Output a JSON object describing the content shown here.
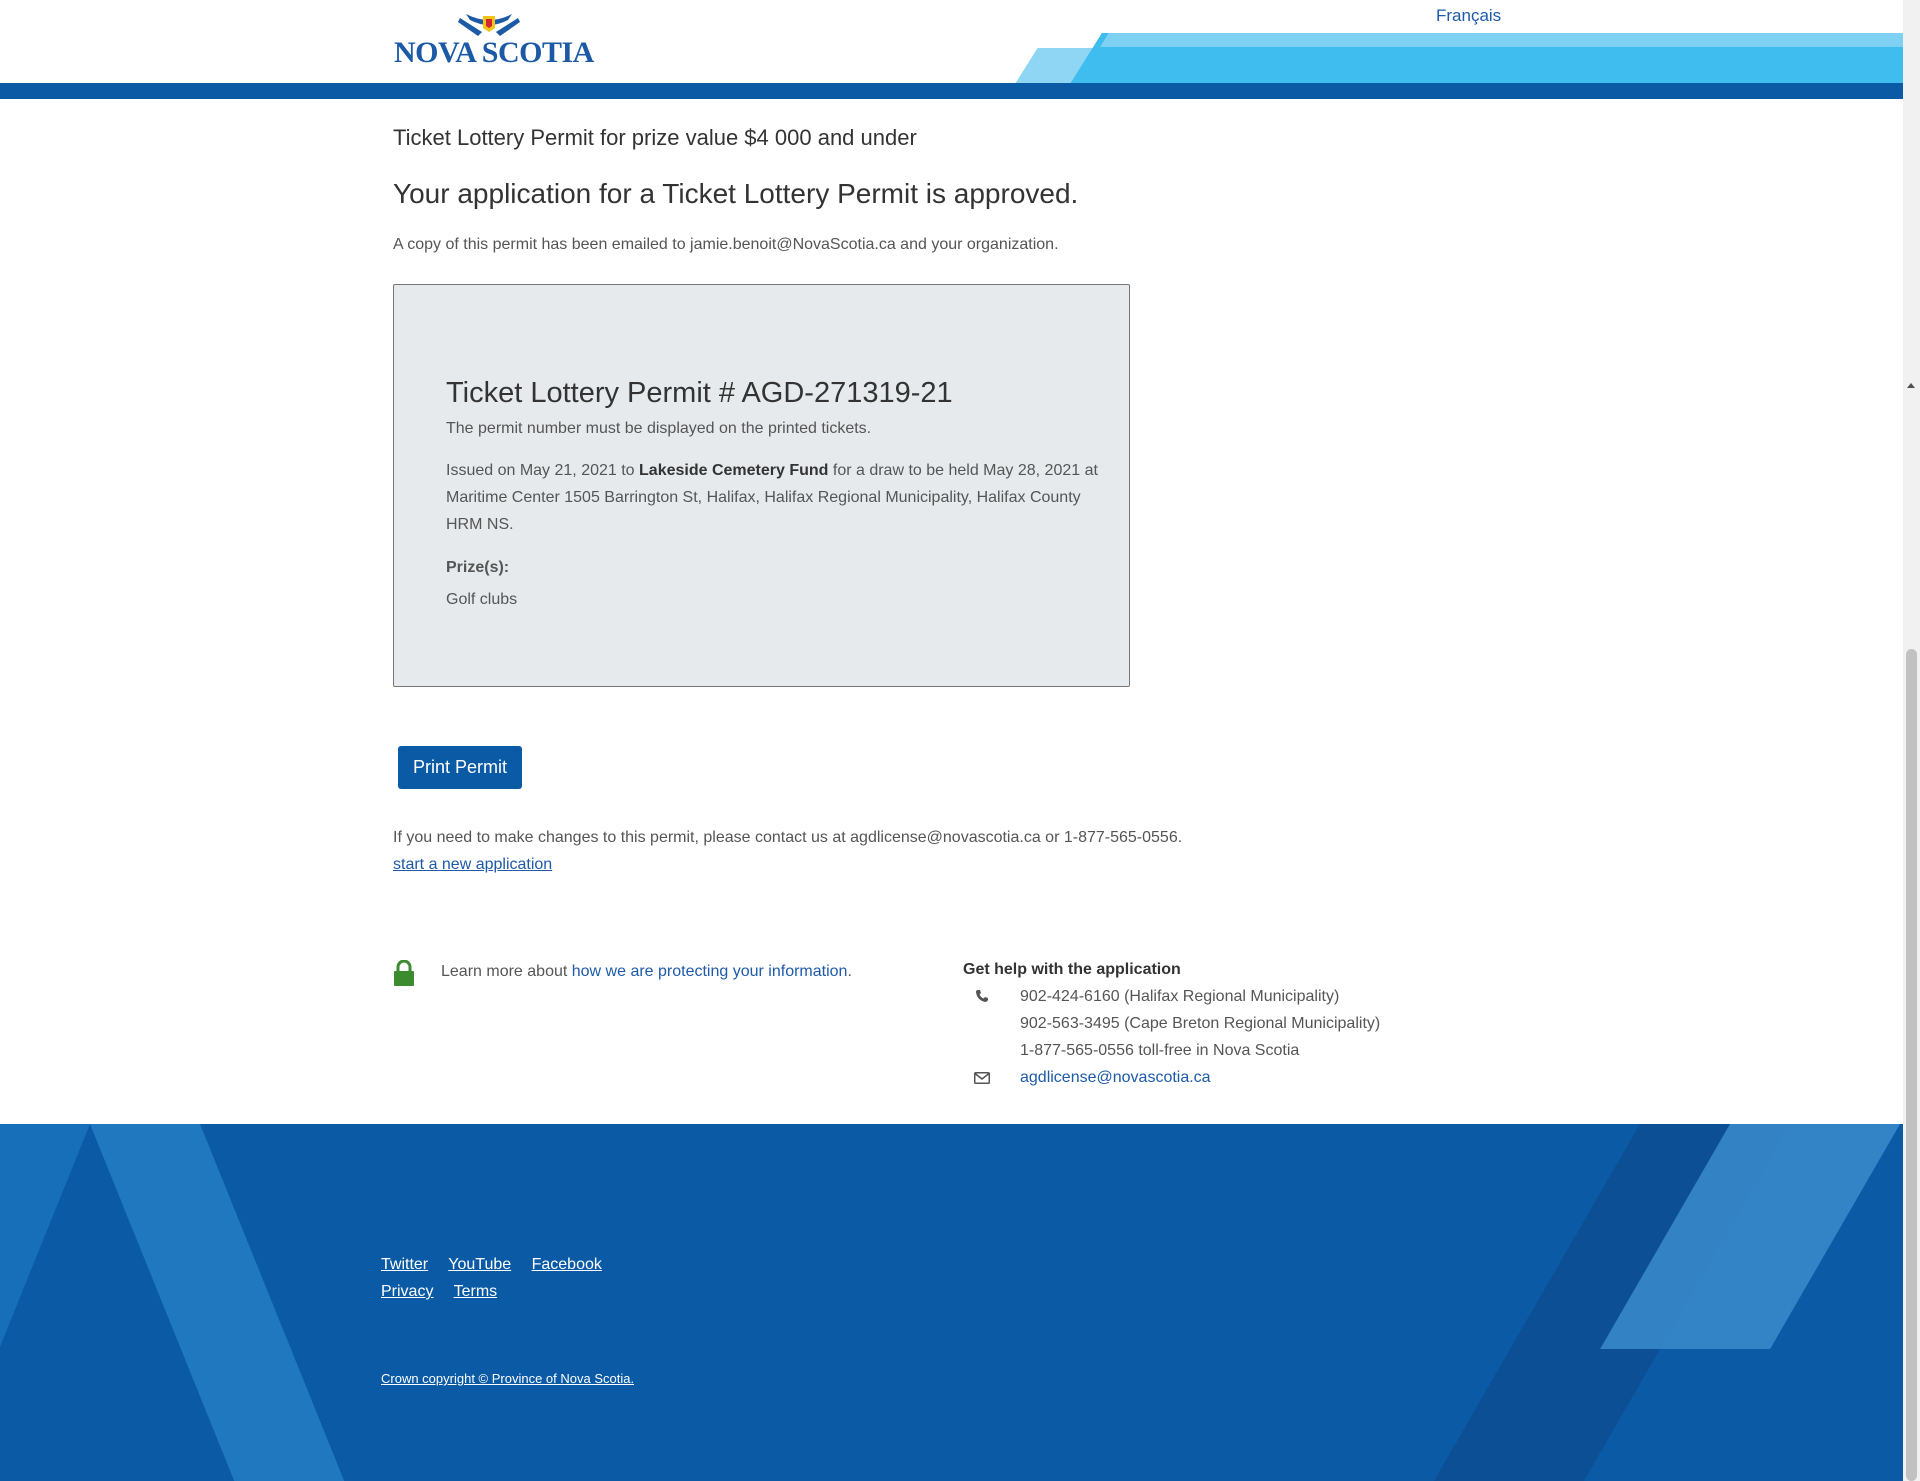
{
  "header": {
    "logo_text": "NOVA SCOTIA",
    "language_link": "Français",
    "colors": {
      "primary_blue": "#0a5aa6",
      "light_blue": "#8fd6f5",
      "sky_blue": "#3fbdee"
    }
  },
  "main": {
    "subtitle": "Ticket Lottery Permit for prize value $4 000 and under",
    "heading": "Your application for a Ticket Lottery Permit is approved.",
    "email_note": "A copy of this permit has been emailed to jamie.benoit@NovaScotia.ca and your organization.",
    "permit": {
      "title": "Ticket Lottery Permit # AGD-271319-21",
      "display_note": "The permit number must be displayed on the printed tickets.",
      "issued_prefix": "Issued on May 21, 2021 to ",
      "organization": "Lakeside Cemetery Fund",
      "issued_suffix": " for a draw to be held May 28, 2021 at Maritime Center 1505 Barrington St, Halifax, Halifax Regional Municipality, Halifax County HRM NS.",
      "prizes_label": "Prize(s):",
      "prizes": [
        "Golf clubs"
      ]
    },
    "print_button": "Print Permit",
    "changes_note": "If you need to make changes to this permit, please contact us at agdlicense@novascotia.ca or 1-877-565-0556.",
    "new_application_link": "start a new application"
  },
  "privacy": {
    "icon": "lock-icon",
    "text": "Learn more about ",
    "link": "how we are protecting your information",
    "suffix": "."
  },
  "help": {
    "title": "Get help with the application",
    "phone_icon": "phone-icon",
    "phones": [
      "902-424-6160 (Halifax Regional Municipality)",
      "902-563-3495 (Cape Breton Regional Municipality)",
      "1-877-565-0556 toll-free in Nova Scotia"
    ],
    "email_icon": "envelope-icon",
    "email": "agdlicense@novascotia.ca"
  },
  "footer": {
    "social": [
      "Twitter",
      "YouTube",
      "Facebook"
    ],
    "legal": [
      "Privacy",
      "Terms"
    ],
    "copyright": "Crown copyright © Province of Nova Scotia."
  }
}
